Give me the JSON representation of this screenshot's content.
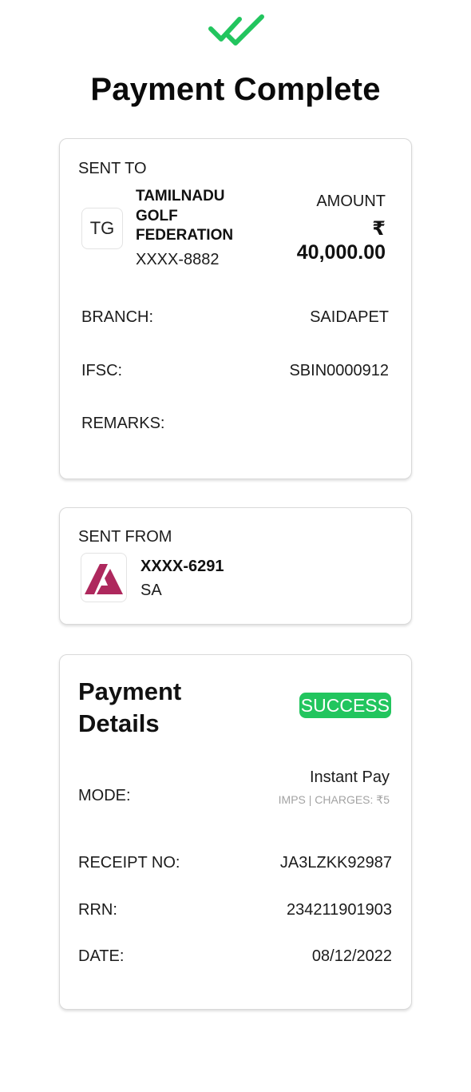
{
  "header": {
    "icon": "double-check-icon",
    "title": "Payment Complete",
    "accent_color": "#22c55e"
  },
  "sent_to": {
    "section_label": "SENT TO",
    "avatar_initials": "TG",
    "payee_name": "TAMILNADU GOLF FEDERATION",
    "account": "XXXX-8882",
    "amount_label": "AMOUNT",
    "currency_symbol": "₹",
    "amount": "40,000.00",
    "branch_label": "BRANCH:",
    "branch_value": "SAIDAPET",
    "ifsc_label": "IFSC:",
    "ifsc_value": "SBIN0000912",
    "remarks_label": "REMARKS:",
    "remarks_value": ""
  },
  "sent_from": {
    "section_label": "SENT FROM",
    "bank_logo_icon": "axis-bank-logo-icon",
    "bank_logo_color": "#ae285d",
    "account": "XXXX-6291",
    "name": "SA"
  },
  "payment_details": {
    "title": "Payment Details",
    "status": "SUCCESS",
    "status_color": "#22c55e",
    "mode_label": "MODE:",
    "mode_value": "Instant Pay",
    "mode_sub": "IMPS | CHARGES: ₹5",
    "receipt_label": "RECEIPT NO:",
    "receipt_value": "JA3LZKK92987",
    "rrn_label": "RRN:",
    "rrn_value": "234211901903",
    "date_label": "DATE:",
    "date_value": "08/12/2022"
  }
}
